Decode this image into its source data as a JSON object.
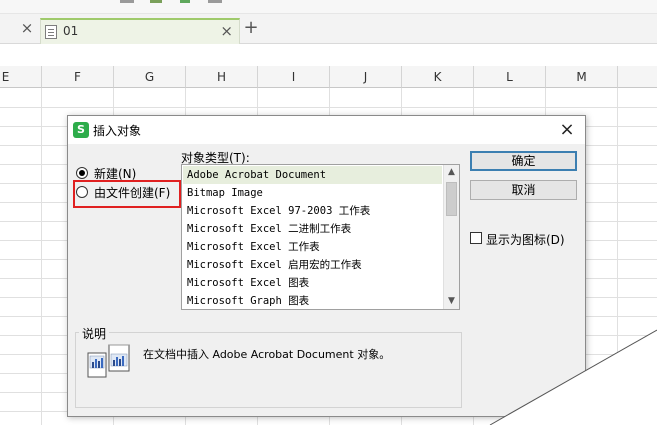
{
  "tabbar": {
    "tab_name": "01",
    "close_glyph": "×",
    "add_glyph": "+"
  },
  "sheet": {
    "columns": [
      "E",
      "F",
      "G",
      "H",
      "I",
      "J",
      "K",
      "L",
      "M"
    ]
  },
  "dialog": {
    "title": "插入对象",
    "close_glyph": "×",
    "radio_new": "新建(N)",
    "radio_from_file": "由文件创建(F)",
    "object_type_label": "对象类型(T):",
    "object_types": [
      "Adobe Acrobat Document",
      "Bitmap Image",
      "Microsoft Excel 97-2003 工作表",
      "Microsoft Excel 二进制工作表",
      "Microsoft Excel 工作表",
      "Microsoft Excel 启用宏的工作表",
      "Microsoft Excel 图表",
      "Microsoft Graph 图表"
    ],
    "selected_index": 0,
    "ok_label": "确定",
    "cancel_label": "取消",
    "display_as_icon_label": "显示为图标(D)",
    "description_title": "说明",
    "description_text": "在文档中插入 Adobe Acrobat Document 对象。",
    "icons": {
      "app": "wps-spreadsheet-icon",
      "description": "chart-object-icon"
    },
    "colors": {
      "app_icon": "#2dac4a",
      "highlight_box": "#e02020",
      "selected_row": "#e7eedd",
      "default_button_border": "#3c7fb1",
      "active_tab_accent": "#9fca6b"
    }
  }
}
